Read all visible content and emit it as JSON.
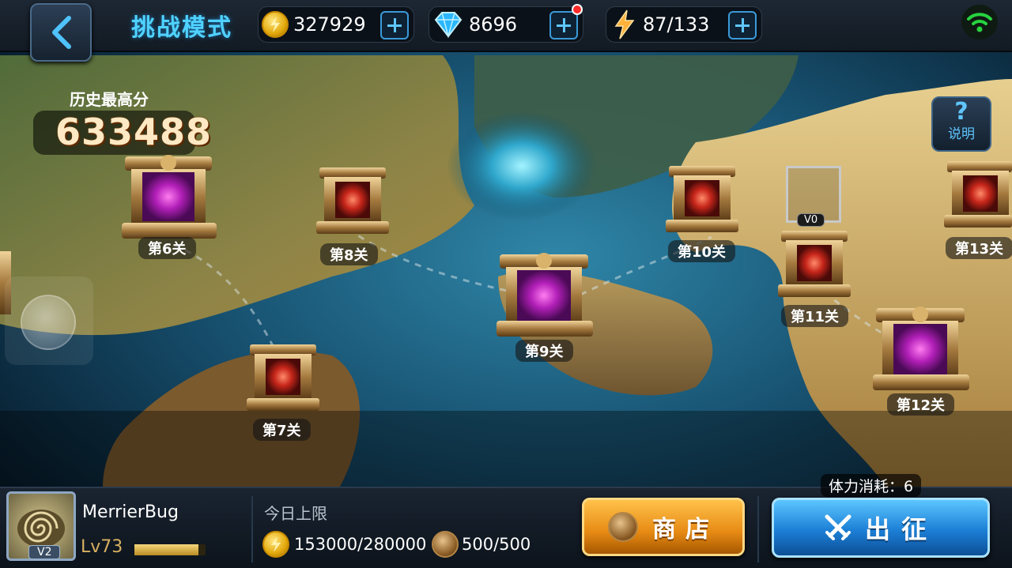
{
  "header": {
    "title": "挑战模式",
    "gold": "327929",
    "diamond": "8696",
    "energy": "87/133"
  },
  "high_score": {
    "label": "历史最高分",
    "value": "633488"
  },
  "help": {
    "label": "说明",
    "symbol": "?"
  },
  "stages": [
    {
      "label": "第6关",
      "type": "boss"
    },
    {
      "label": "第7关",
      "type": "normal"
    },
    {
      "label": "第8关",
      "type": "normal"
    },
    {
      "label": "第9关",
      "type": "boss"
    },
    {
      "label": "第10关",
      "type": "normal"
    },
    {
      "label": "第11关",
      "type": "normal"
    },
    {
      "label": "第12关",
      "type": "boss"
    },
    {
      "label": "第13关",
      "type": "normal"
    }
  ],
  "current_marker": {
    "tag": "V0"
  },
  "player": {
    "name": "MerrierBug",
    "level": "Lv73",
    "vip": "V2",
    "xp_fraction": 0.9
  },
  "daily_limit": {
    "title": "今日上限",
    "gold": "153000/280000",
    "horse": "500/500"
  },
  "buttons": {
    "shop": "商店",
    "go": "出征"
  },
  "stamina_cost": "体力消耗：6",
  "colors": {
    "title": "#4fd2ff",
    "shop": "#e68a14",
    "go": "#1c7fd6"
  }
}
